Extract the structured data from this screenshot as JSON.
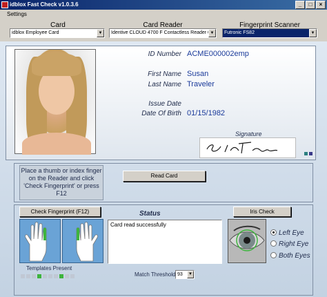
{
  "window": {
    "title": "idblox Fast Check  v1.0.3.6"
  },
  "menu": {
    "settings": "Settings"
  },
  "selectors": {
    "card": {
      "label": "Card",
      "value": "idblox Employee Card"
    },
    "reader": {
      "label": "Card Reader",
      "value": "Identive CLOUD 4700 F Contactless Reader 0"
    },
    "scanner": {
      "label": "Fingerprint Scanner",
      "value": "Futronic FS82"
    }
  },
  "card": {
    "labels": {
      "id_number": "ID Number",
      "first_name": "First Name",
      "last_name": "Last Name",
      "issue_date": "Issue Date",
      "date_of_birth": "Date Of Birth",
      "signature": "Signature"
    },
    "values": {
      "id_number": "ACME000002emp",
      "first_name": "Susan",
      "last_name": "Traveler",
      "issue_date": "",
      "date_of_birth": "01/15/1982"
    },
    "signature_color": "#1a1a1a"
  },
  "instructions": "Place a thumb or index finger on the Reader and click 'Check Fingerprint' or press F12",
  "buttons": {
    "read_card": "Read Card",
    "check_fingerprint": "Check Fingerprint (F12)",
    "iris_check": "Iris Check"
  },
  "status": {
    "label": "Status",
    "text": "Card read successfully"
  },
  "eye_options": {
    "left": "Left Eye",
    "right": "Right Eye",
    "both": "Both Eyes",
    "selected": "left"
  },
  "templates": {
    "label": "Templates Present",
    "slots": [
      false,
      false,
      false,
      true,
      false,
      false,
      false,
      true,
      false,
      false
    ]
  },
  "threshold": {
    "label": "Match Threshold",
    "value": "93"
  },
  "colors": {
    "accent": "#1a3a9a",
    "finger_highlight": "#3db43d",
    "hand_bg": "#6aa3d6"
  },
  "icons": {
    "app": "app-icon",
    "minimize": "minimize-icon",
    "maximize": "maximize-icon",
    "close": "close-icon",
    "dropdown": "chevron-down-icon",
    "left_hand": "left-hand-icon",
    "right_hand": "right-hand-icon",
    "eye": "eye-icon"
  }
}
